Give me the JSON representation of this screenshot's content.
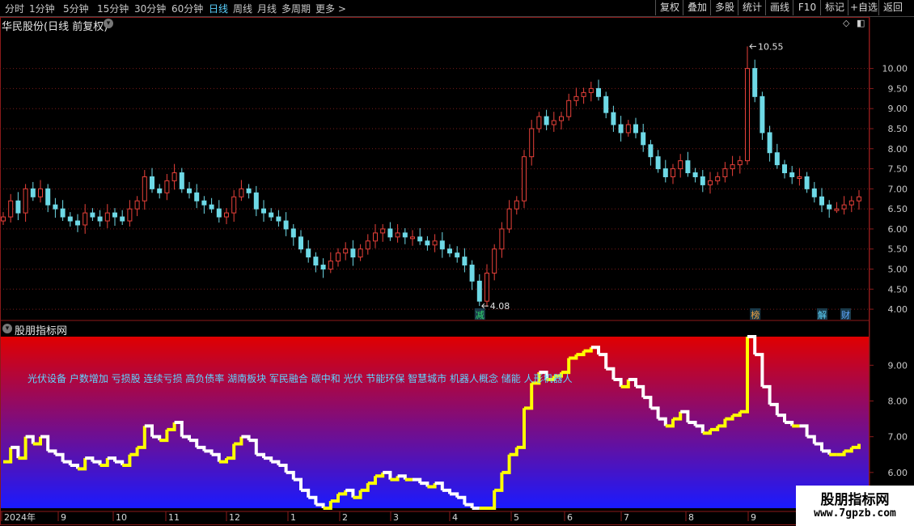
{
  "toolbar": {
    "periods": [
      "分时",
      "1分钟",
      "5分钟",
      "15分钟",
      "30分钟",
      "60分钟",
      "日线",
      "周线",
      "月线",
      "多周期",
      "更多 >"
    ],
    "active_period": "日线",
    "buttons": [
      "复权",
      "叠加",
      "多股",
      "统计",
      "画线",
      "F10",
      "标记",
      "+自选",
      "返回"
    ]
  },
  "main_panel": {
    "title": "华民股份(日线 前复权)"
  },
  "indicator_panel": {
    "title": "股朋指标网",
    "concepts": "光伏设备 户数增加 亏损股 连续亏损 高负债率 湖南板块 军民融合 碳中和 光伏 节能环保 智慧城市 机器人概念 储能 人形机器人",
    "concept_color": "#5fd6ff"
  },
  "watermark": {
    "name": "股朋指标网",
    "url": "www.7gpzb.com"
  },
  "colors": {
    "up": "#e8413a",
    "down": "#6ed9e6",
    "grid": "#7a1a1a",
    "axis_text": "#c8c8c8",
    "frame": "#8b1a1a"
  },
  "chart_data": [
    {
      "type": "candlestick",
      "title": "华民股份(日线 前复权)",
      "ylim": [
        3.8,
        10.9
      ],
      "yticks": [
        4.0,
        4.5,
        5.0,
        5.5,
        6.0,
        6.5,
        7.0,
        7.5,
        8.0,
        8.5,
        9.0,
        9.5,
        10.0
      ],
      "annotations": [
        {
          "text": "10.55",
          "kind": "high",
          "value": 10.55,
          "date": "2024-09"
        },
        {
          "text": "4.08",
          "kind": "low",
          "value": 4.08,
          "date": "2024-04"
        }
      ],
      "markers": [
        {
          "text": "减",
          "color": "#2fd66a",
          "date": "2024-04"
        },
        {
          "text": "榜",
          "color": "#f0a040",
          "date": "2024-08"
        },
        {
          "text": "解",
          "color": "#5fd6ff",
          "date": "2024-09"
        },
        {
          "text": "财",
          "color": "#5fa8ff",
          "date": "2024-10"
        }
      ],
      "closes": [
        6.3,
        6.7,
        6.4,
        7.0,
        6.8,
        7.0,
        6.6,
        6.5,
        6.3,
        6.2,
        6.1,
        6.4,
        6.3,
        6.2,
        6.4,
        6.3,
        6.2,
        6.5,
        6.7,
        7.3,
        7.0,
        6.9,
        7.2,
        7.4,
        7.0,
        6.9,
        6.7,
        6.6,
        6.5,
        6.3,
        6.4,
        6.8,
        7.0,
        6.9,
        6.5,
        6.4,
        6.3,
        6.2,
        6.0,
        5.8,
        5.5,
        5.3,
        5.1,
        5.0,
        5.2,
        5.4,
        5.5,
        5.3,
        5.5,
        5.7,
        5.9,
        6.0,
        5.8,
        5.9,
        5.8,
        5.8,
        5.7,
        5.6,
        5.7,
        5.5,
        5.4,
        5.3,
        5.1,
        4.7,
        4.2,
        4.9,
        5.5,
        6.0,
        6.5,
        6.7,
        7.8,
        8.5,
        8.8,
        8.6,
        8.7,
        8.8,
        9.2,
        9.3,
        9.4,
        9.5,
        9.3,
        8.9,
        8.6,
        8.4,
        8.6,
        8.4,
        8.1,
        7.8,
        7.5,
        7.3,
        7.5,
        7.7,
        7.4,
        7.3,
        7.1,
        7.2,
        7.3,
        7.5,
        7.6,
        7.7,
        10.0,
        9.3,
        8.4,
        7.9,
        7.6,
        7.4,
        7.3,
        7.3,
        7.0,
        6.8,
        6.6,
        6.5,
        6.5,
        6.6,
        6.7,
        6.8
      ],
      "x_labels": [
        "2024年",
        "9",
        "10",
        "11",
        "12",
        "1",
        "2",
        "3",
        "4",
        "5",
        "6",
        "7",
        "8",
        "9"
      ]
    },
    {
      "type": "line",
      "name": "股朋指标网",
      "ylim": [
        5.0,
        9.8
      ],
      "yticks": [
        6.0,
        7.0,
        8.0,
        9.0
      ],
      "line_colors": {
        "up": "#ffff00",
        "down": "#ffffff"
      },
      "background_gradient": [
        "#e00000",
        "#1a1aff"
      ]
    }
  ]
}
